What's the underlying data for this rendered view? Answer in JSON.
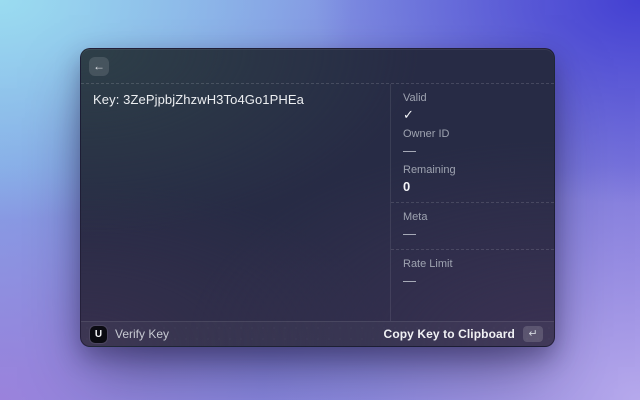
{
  "window": {
    "header": {
      "back_icon": "←"
    },
    "main": {
      "key_text": "Key: 3ZePjpbjZhzwH3To4Go1PHEa"
    },
    "footer": {
      "extension_icon_letter": "U",
      "command_name": "Verify Key",
      "primary_action": "Copy Key to Clipboard",
      "shortcut_key": "↵"
    }
  },
  "details": {
    "sections": [
      {
        "fields": [
          {
            "label": "Valid",
            "value": "✓"
          },
          {
            "label": "Owner ID",
            "value": "—"
          },
          {
            "label": "Remaining",
            "value": "0"
          }
        ]
      },
      {
        "fields": [
          {
            "label": "Meta",
            "value": "—"
          }
        ]
      },
      {
        "fields": [
          {
            "label": "Rate Limit",
            "value": "—"
          }
        ]
      }
    ]
  },
  "colors": {
    "bg_top_left": "#9adcf0",
    "bg_top_right": "#4340d2",
    "bg_bottom_right": "#b6a9ec",
    "bg_bottom_left": "#9a82dc",
    "window_tint_top_left": "#2e4048",
    "window_tint_bottom_right": "#3c3254",
    "label_gray": "#9ea3b0",
    "value_white": "#f3f4f7"
  }
}
